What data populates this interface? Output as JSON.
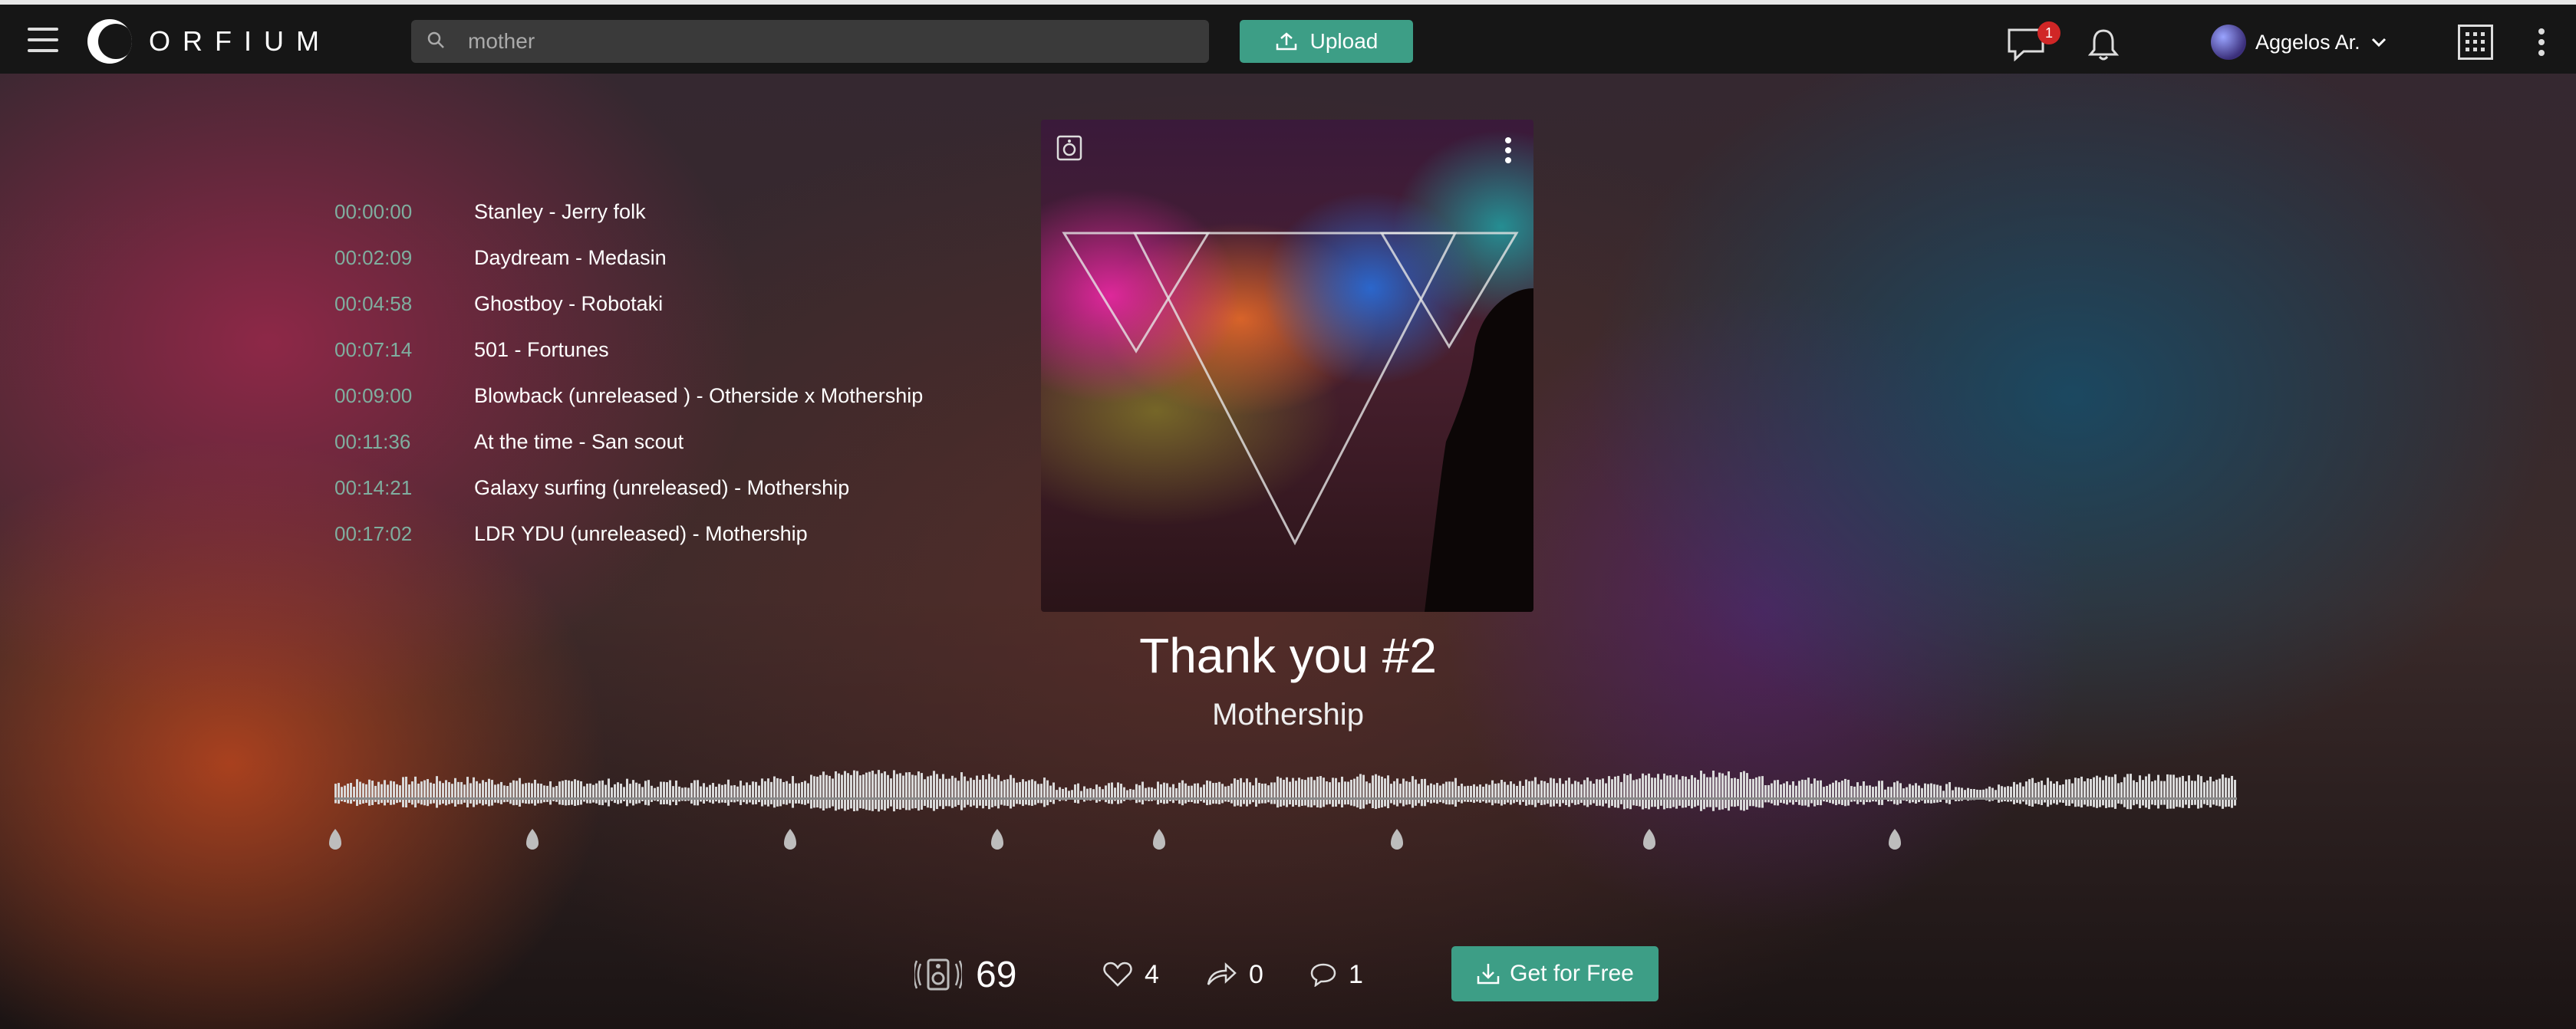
{
  "header": {
    "logo_text": "ORFIUM",
    "search_value": "mother",
    "upload_label": "Upload",
    "messages_badge": "1",
    "user_name": "Aggelos Ar."
  },
  "tracklist": [
    {
      "time": "00:00:00",
      "title": "Stanley - Jerry folk"
    },
    {
      "time": "00:02:09",
      "title": "Daydream - Medasin"
    },
    {
      "time": "00:04:58",
      "title": "Ghostboy - Robotaki"
    },
    {
      "time": "00:07:14",
      "title": "501 - Fortunes"
    },
    {
      "time": "00:09:00",
      "title": "Blowback (unreleased ) - Otherside x Mothership"
    },
    {
      "time": "00:11:36",
      "title": "At the time - San scout"
    },
    {
      "time": "00:14:21",
      "title": "Galaxy surfing (unreleased) - Mothership"
    },
    {
      "time": "00:17:02",
      "title": "LDR YDU (unreleased) - Mothership"
    }
  ],
  "track": {
    "title": "Thank you #2",
    "artist": "Mothership"
  },
  "stats": {
    "plays": "69",
    "likes": "4",
    "reposts": "0",
    "comments": "1"
  },
  "get_button_label": "Get for Free",
  "colors": {
    "accent": "#3d9e86",
    "badge": "#d02626",
    "time_text": "#7fae9f"
  },
  "icons": [
    "hamburger-icon",
    "search-icon",
    "upload-icon",
    "chat-icon",
    "bell-icon",
    "chevron-down-icon",
    "apps-grid-icon",
    "more-vertical-icon",
    "speaker-icon",
    "heart-icon",
    "repost-icon",
    "comment-icon",
    "download-icon"
  ]
}
